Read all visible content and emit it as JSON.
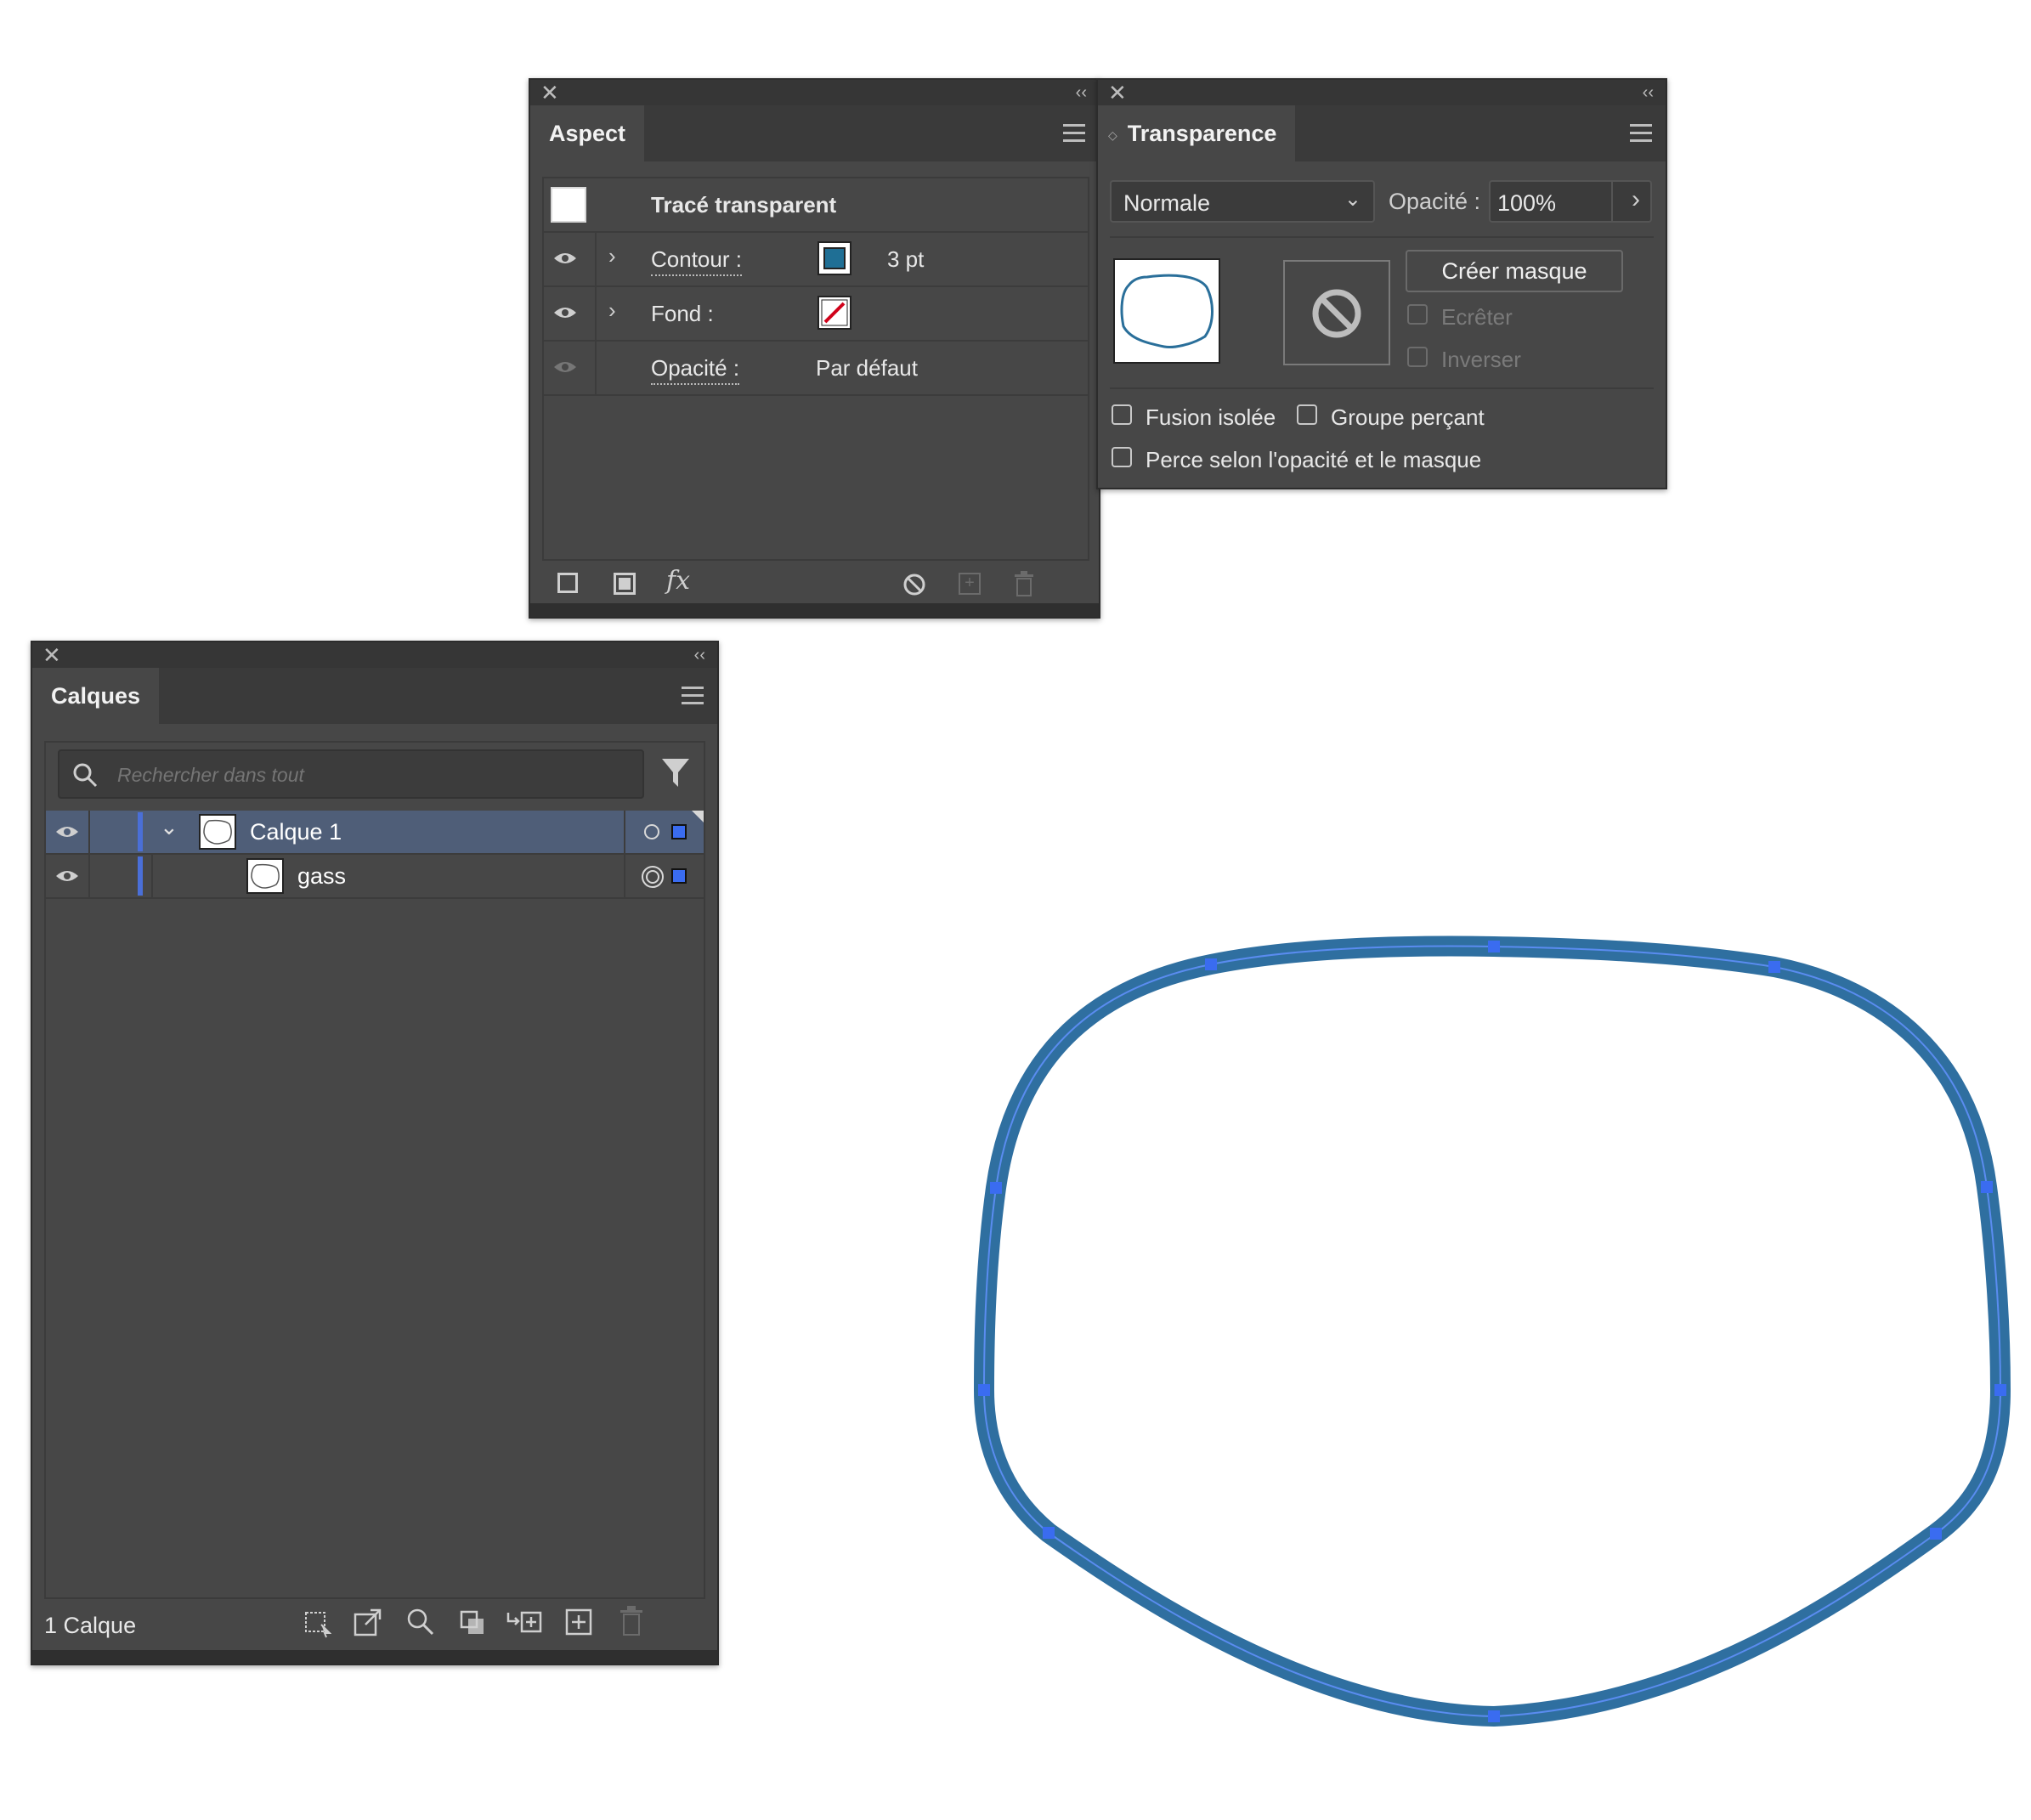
{
  "aspect": {
    "tab": "Aspect",
    "header": "Tracé transparent",
    "rows": [
      {
        "label": "Contour :",
        "value": "3 pt"
      },
      {
        "label": "Fond :",
        "value": ""
      },
      {
        "label": "Opacité :",
        "value": "Par défaut"
      }
    ],
    "colors": {
      "stroke_swatch": "#1f6f95",
      "none_slash": "#d0021b"
    }
  },
  "transparence": {
    "tab": "Transparence",
    "blend_mode": "Normale",
    "opacity_label": "Opacité :",
    "opacity_value": "100%",
    "create_mask": "Créer masque",
    "clip": "Ecrêter",
    "invert": "Inverser",
    "isolate": "Fusion isolée",
    "knockout": "Groupe perçant",
    "knockout_shape": "Perce selon l'opacité et le masque"
  },
  "calques": {
    "tab": "Calques",
    "search_placeholder": "Rechercher dans tout",
    "layers": [
      {
        "name": "Calque 1"
      },
      {
        "name": "gass"
      }
    ],
    "status": "1 Calque",
    "colors": {
      "selection_bar": "#4a6fd8",
      "row_selected": "#4f5e78"
    }
  },
  "canvas": {
    "colors": {
      "path_stroke": "#2f6fa0",
      "anchor": "#3a6cf0"
    }
  }
}
